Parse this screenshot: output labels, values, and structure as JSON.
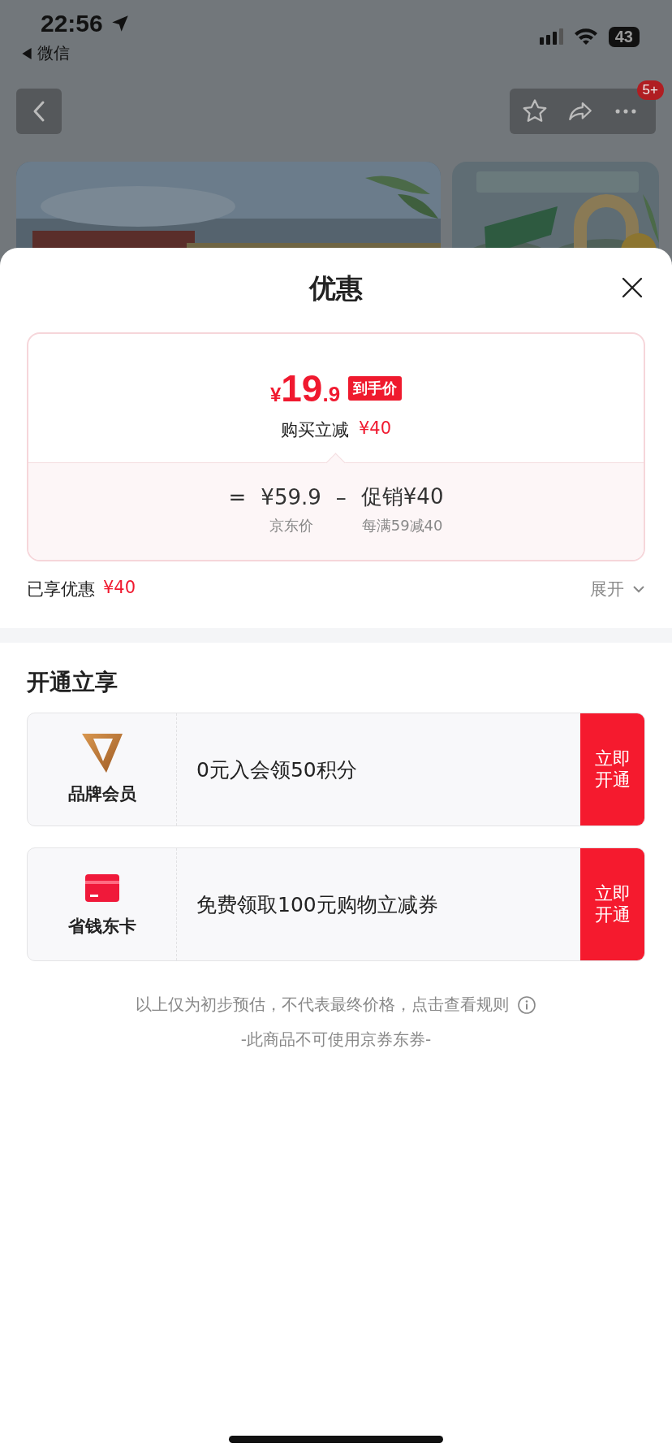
{
  "status_bar": {
    "time": "22:56",
    "back_app": "微信",
    "battery": "43"
  },
  "nav": {
    "more_badge": "5+"
  },
  "sheet": {
    "title": "优惠",
    "price": {
      "currency": "¥",
      "integer": "19",
      "decimal": ".9",
      "tag": "到手价"
    },
    "reduction": {
      "label": "购买立减",
      "amount": "¥40"
    },
    "formula": {
      "equals": "=",
      "base": "¥59.9",
      "minus": "–",
      "promo_label": "促销",
      "promo_amount": "¥40",
      "base_caption": "京东价",
      "promo_caption": "每满59减40"
    },
    "enjoyed": {
      "label": "已享优惠",
      "amount": "¥40"
    },
    "expand": {
      "label": "展开",
      "expanded": false
    },
    "section_title": "开通立享",
    "offers": [
      {
        "kind": "brand-member",
        "name": "品牌会员",
        "text": "0元入会领50积分",
        "action": "立即开通"
      },
      {
        "kind": "savings-card",
        "name": "省钱东卡",
        "text": "免费领取100元购物立减券",
        "action": "立即开通"
      }
    ],
    "notice": "以上仅为初步预估，不代表最终价格，点击查看规则",
    "rule_note": "-此商品不可使用京券东券-"
  }
}
